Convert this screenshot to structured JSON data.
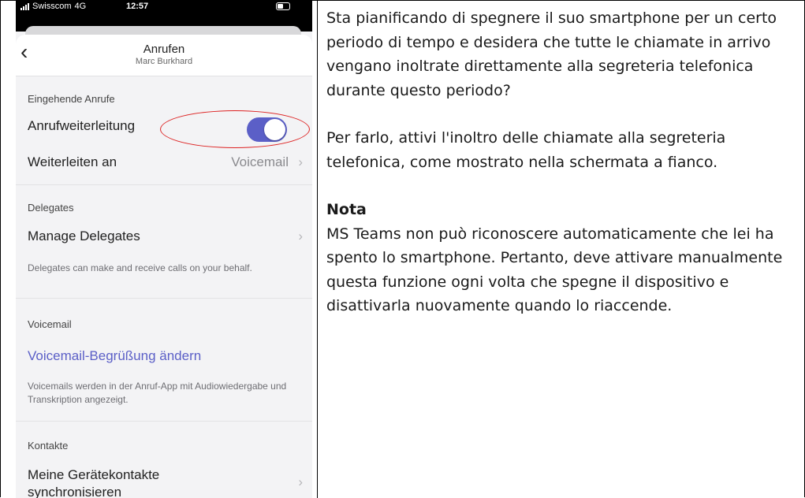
{
  "phone": {
    "status": {
      "carrier": "Swisscom",
      "network": "4G",
      "time": "12:57"
    },
    "header": {
      "title": "Anrufen",
      "subtitle": "Marc Burkhard",
      "back_icon": "chevron-left-icon"
    },
    "incoming": {
      "section_title": "Eingehende Anrufe",
      "forwarding_label": "Anrufweiterleitung",
      "forwarding_enabled": true,
      "forward_to_label": "Weiterleiten an",
      "forward_to_value": "Voicemail"
    },
    "delegates": {
      "section_title": "Delegates",
      "manage_label": "Manage Delegates",
      "description": "Delegates can make and receive calls on your behalf."
    },
    "voicemail": {
      "section_title": "Voicemail",
      "greeting_link": "Voicemail-Begrüßung ändern",
      "description": "Voicemails werden in der Anruf-App mit Audiowiedergabe und Transkription angezeigt."
    },
    "contacts": {
      "section_title": "Kontakte",
      "sync_label_line1": "Meine Gerätekontakte",
      "sync_label_line2": "synchronisieren"
    },
    "accent_color": "#5b5fc7",
    "highlight_color": "#d22222"
  },
  "instructions": {
    "paragraph1": "Sta pianificando di spegnere il suo smartphone per un certo periodo di tempo e desidera che tutte le chiamate in arrivo vengano inoltrate direttamente alla segreteria telefonica durante questo periodo?",
    "paragraph2": "Per farlo, attivi l'inoltro delle chiamate alla segreteria telefonica, come mostrato nella schermata a fianco.",
    "note_heading": "Nota",
    "note_text": "MS Teams non può riconoscere automaticamente che lei ha spento lo smartphone. Pertanto, deve attivare manualmente questa funzione ogni volta che spegne il dispositivo e disattivarla nuovamente quando lo riaccende."
  }
}
